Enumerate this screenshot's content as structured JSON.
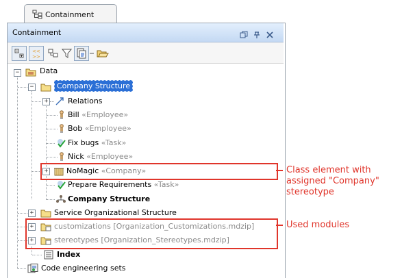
{
  "tab": {
    "label": "Containment"
  },
  "panel": {
    "title": "Containment",
    "controls": [
      "restore-icon",
      "pin-icon",
      "close-icon"
    ]
  },
  "toolbar": {
    "buttons": [
      "collapse-all-icon",
      "expand-all-icon",
      "show-auxiliary-icon",
      "filter-icon",
      "sync-icon",
      "open-icon"
    ]
  },
  "tree": {
    "root": "Data",
    "company_structure": "Company Structure",
    "relations": "Relations",
    "bill": {
      "name": "Bill",
      "stereotype": "«Employee»"
    },
    "bob": {
      "name": "Bob",
      "stereotype": "«Employee»"
    },
    "fix_bugs": {
      "name": "Fix bugs",
      "stereotype": "«Task»"
    },
    "nick": {
      "name": "Nick",
      "stereotype": "«Employee»"
    },
    "nomagic": {
      "name": "NoMagic",
      "stereotype": "«Company»"
    },
    "prepare": {
      "name": "Prepare Requirements",
      "stereotype": "«Task»"
    },
    "company_structure_diagram": "Company Structure",
    "service_org": "Service Organizational Structure",
    "customizations": "customizations [Organization_Customizations.mdzip]",
    "stereotypes": "stereotypes [Organization_Stereotypes.mdzip]",
    "index": "Index",
    "code_sets": "Code engineering sets"
  },
  "annotations": {
    "class_element": "Class element with\nassigned \"Company\"\nstereotype",
    "used_modules": "Used modules"
  },
  "colors": {
    "annotation": "#e0352b",
    "selection": "#2b6fd6"
  }
}
